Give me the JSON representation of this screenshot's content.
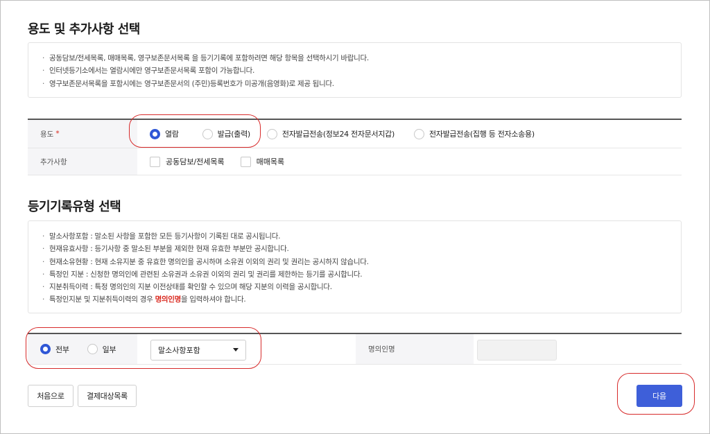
{
  "usage_section": {
    "title": "용도 및 추가사항 선택",
    "notices": [
      "공동담보/전세목록, 매매목록, 영구보존문서목록 을 등기기록에 포함하려면 해당 항목을 선택하시기 바랍니다.",
      "인터넷등기소에서는 열람시에만 영구보존문서목록 포함이 가능합니다.",
      "영구보존문서목록을 포함시에는 영구보존문서의 (주민)등록번호가 미공개(음영화)로 제공 됩니다."
    ],
    "usage_label": "용도",
    "required_mark": "*",
    "usage_options": [
      {
        "label": "열람",
        "selected": true
      },
      {
        "label": "발급(출력)",
        "selected": false
      },
      {
        "label": "전자발급전송(정보24 전자문서지갑)",
        "selected": false
      },
      {
        "label": "전자발급전송(집행 등 전자소송용)",
        "selected": false
      }
    ],
    "extra_label": "추가사항",
    "extra_options": [
      {
        "label": "공동담보/전세목록",
        "checked": false
      },
      {
        "label": "매매목록",
        "checked": false
      }
    ]
  },
  "type_section": {
    "title": "등기기록유형 선택",
    "notices": [
      "말소사항포함 : 말소된 사항을 포함한 모든 등기사항이 기록된 대로 공시됩니다.",
      "현재유효사항 : 등기사항 중 말소된 부분을 제외한 현재 유효한 부분만 공시합니다.",
      "현재소유현황 : 현재 소유지분 중 유효한 명의인을 공시하며 소유권 이외의 권리 및 권리는 공시하지 않습니다.",
      "특정인 지분 : 신청한 명의인에 관련된 소유권과 소유권 이외의 권리 및 권리를 제한하는 등기를 공시합니다.",
      "지분취득이력 : 특정 명의인의 지분 이전상태를 확인할 수 있으며 해당 지분의 이력을 공시합니다."
    ],
    "last_notice_prefix": "특정인지분 및 지분취득이력의 경우 ",
    "last_notice_highlight": "명의인명",
    "last_notice_suffix": "을 입력하셔야 합니다.",
    "scope_options": [
      {
        "label": "전부",
        "selected": true
      },
      {
        "label": "일부",
        "selected": false
      }
    ],
    "record_type_selected": "말소사항포함",
    "name_label": "명의인명",
    "name_value": ""
  },
  "buttons": {
    "first": "처음으로",
    "payment_list": "결제대상목록",
    "next": "다음"
  },
  "colors": {
    "accent": "#3e5fd9",
    "radio_on": "#2f57d6",
    "required": "#d9261c",
    "annotation_ring": "#d72a2a"
  }
}
